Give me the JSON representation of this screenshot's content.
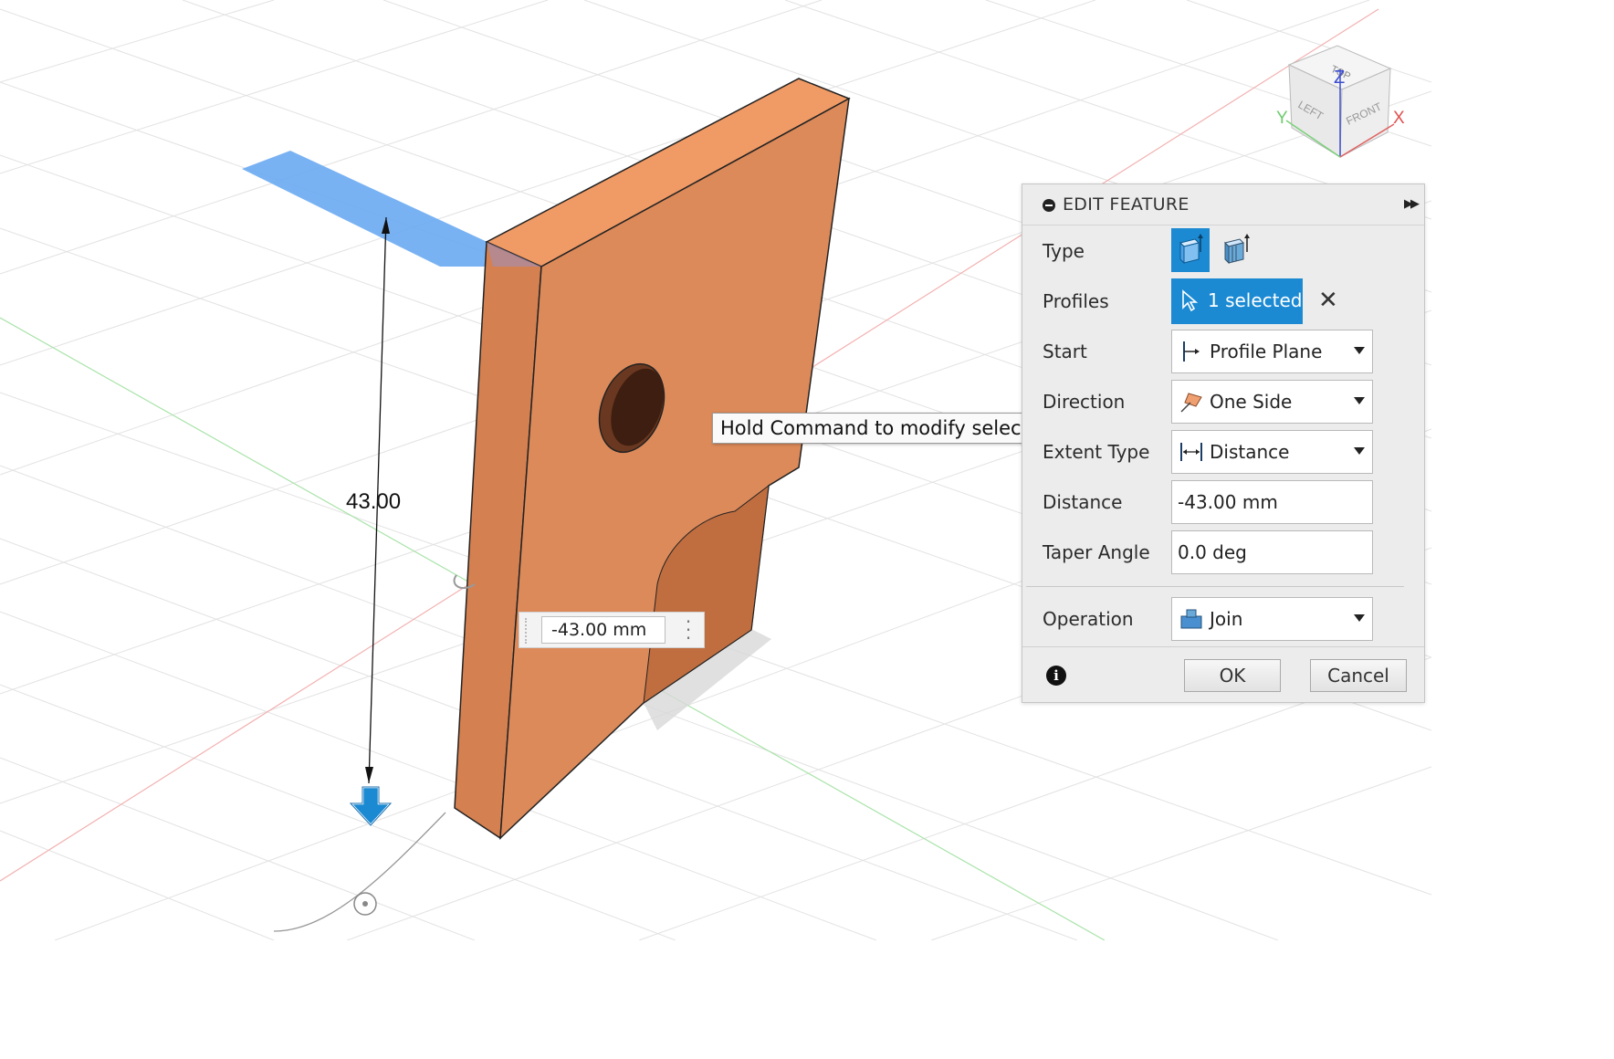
{
  "viewport": {
    "dimension_value": "43.00",
    "dimension_input_value": "-43.00 mm",
    "tooltip": "Hold Command to modify selection",
    "icons": [
      "extrude-arrow-icon",
      "drag-handle-icon",
      "rotate-handle-icon"
    ]
  },
  "viewcube": {
    "top_label": "TOP",
    "left_label": "LEFT",
    "front_label": "FRONT",
    "axis_x": "X",
    "axis_y": "Y",
    "axis_z": "Z"
  },
  "panel": {
    "title": "EDIT FEATURE",
    "type_label": "Type",
    "profiles_label": "Profiles",
    "profiles_value": "1 selected",
    "start_label": "Start",
    "start_value": "Profile Plane",
    "direction_label": "Direction",
    "direction_value": "One Side",
    "extent_label": "Extent Type",
    "extent_value": "Distance",
    "distance_label": "Distance",
    "distance_value": "-43.00 mm",
    "taper_label": "Taper Angle",
    "taper_value": "0.0 deg",
    "operation_label": "Operation",
    "operation_value": "Join",
    "ok_label": "OK",
    "cancel_label": "Cancel",
    "info_symbol": "i",
    "clear_symbol": "✕"
  },
  "colors": {
    "accent": "#1b8ad3",
    "body_front": "#dc8a5a",
    "body_top": "#f09a65",
    "profile_highlight": "#6aaaf2"
  }
}
